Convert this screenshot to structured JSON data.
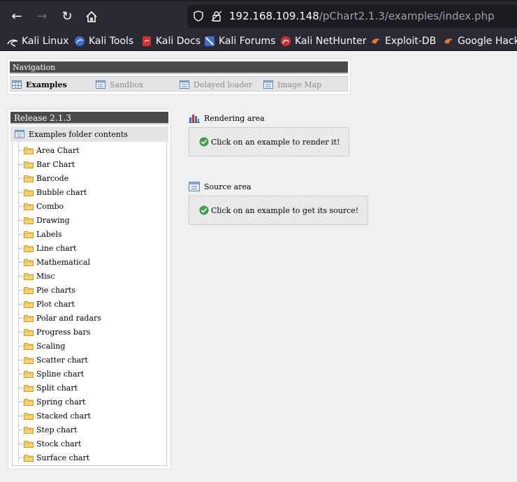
{
  "browser": {
    "url_host": "192.168.109.148",
    "url_path": "/pChart2.1.3/examples/index.php",
    "bookmarks": [
      {
        "label": "Kali Linux",
        "icon": "kali-dragon-icon"
      },
      {
        "label": "Kali Tools",
        "icon": "kali-tools-icon"
      },
      {
        "label": "Kali Docs",
        "icon": "kali-docs-icon"
      },
      {
        "label": "Kali Forums",
        "icon": "kali-forums-icon"
      },
      {
        "label": "Kali NetHunter",
        "icon": "kali-nethunter-icon"
      },
      {
        "label": "Exploit-DB",
        "icon": "exploit-db-icon"
      },
      {
        "label": "Google Hacki",
        "icon": "google-hacking-icon"
      }
    ]
  },
  "navigation": {
    "title": "Navigation",
    "items": [
      {
        "label": "Examples",
        "active": true
      },
      {
        "label": "Sandbox",
        "active": false
      },
      {
        "label": "Delayed loader",
        "active": false
      },
      {
        "label": "Image Map",
        "active": false
      }
    ]
  },
  "release": {
    "title": "Release 2.1.3",
    "folder_header": "Examples folder contents",
    "folders": [
      "Area Chart",
      "Bar Chart",
      "Barcode",
      "Bubble chart",
      "Combo",
      "Drawing",
      "Labels",
      "Line chart",
      "Mathematical",
      "Misc",
      "Pie charts",
      "Plot chart",
      "Polar and radars",
      "Progress bars",
      "Scaling",
      "Scatter chart",
      "Spline chart",
      "Split chart",
      "Spring chart",
      "Stacked chart",
      "Step chart",
      "Stock chart",
      "Surface chart"
    ]
  },
  "rendering": {
    "title": "Rendering area",
    "message": "Click on an example to render it!"
  },
  "source": {
    "title": "Source area",
    "message": "Click on an example to get its source!"
  }
}
